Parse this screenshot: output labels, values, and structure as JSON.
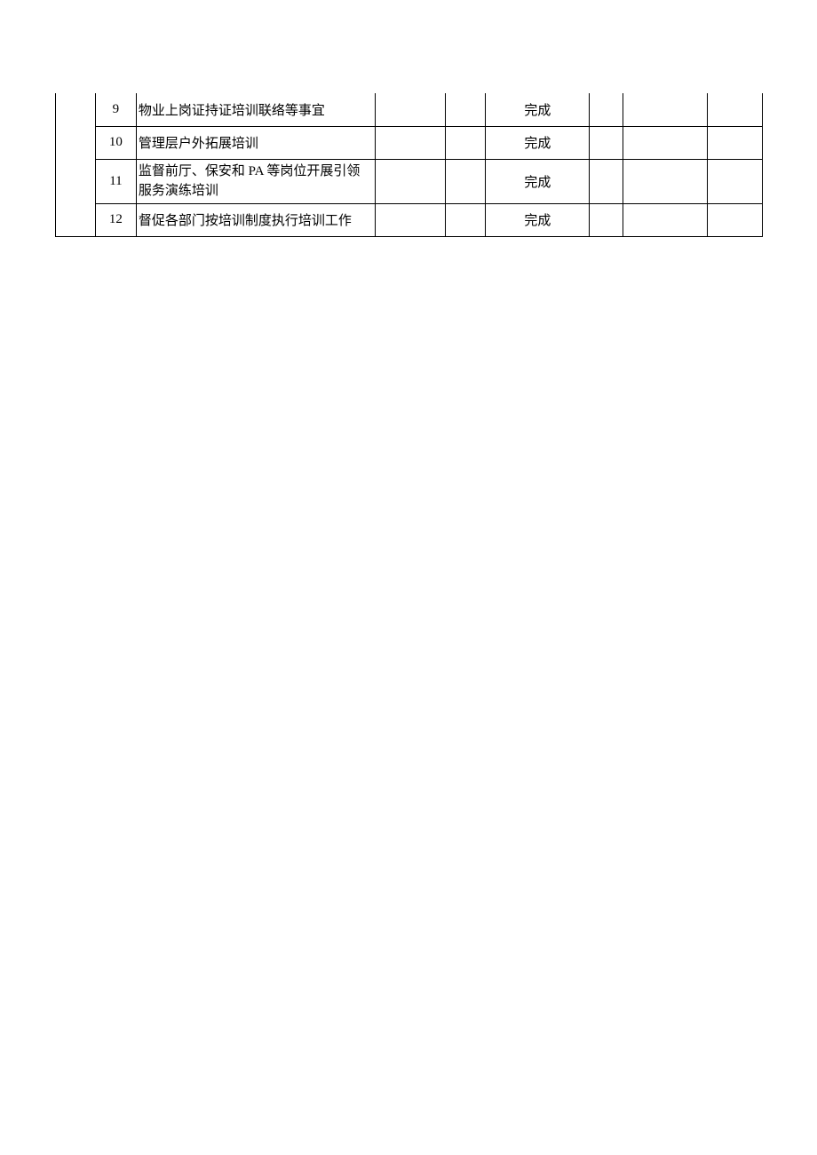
{
  "rows": [
    {
      "num": "9",
      "desc": "物业上岗证持证培训联络等事宜",
      "status": "完成"
    },
    {
      "num": "10",
      "desc": "管理层户外拓展培训",
      "status": "完成"
    },
    {
      "num": "11",
      "desc": "监督前厅、保安和 PA 等岗位开展引领服务演练培训",
      "status": "完成"
    },
    {
      "num": "12",
      "desc": "督促各部门按培训制度执行培训工作",
      "status": "完成"
    }
  ]
}
